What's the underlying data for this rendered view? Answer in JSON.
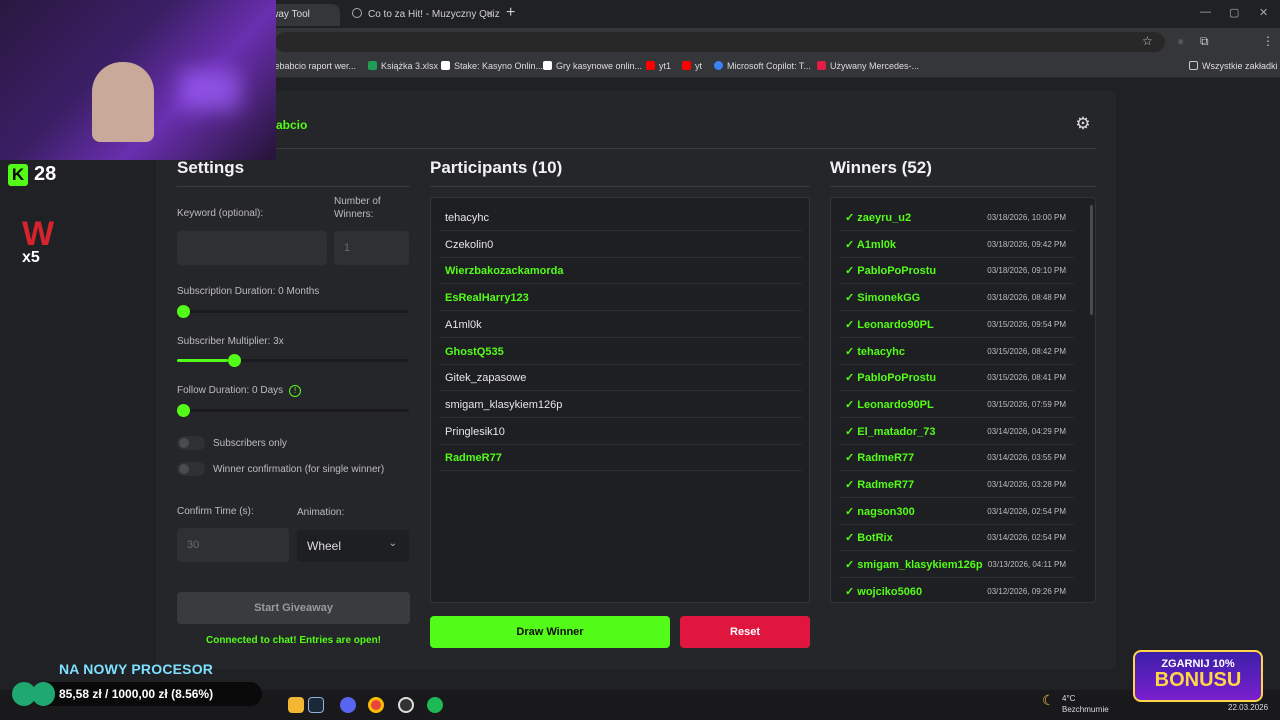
{
  "browser": {
    "tabs": [
      {
        "label": "eaway Tool"
      },
      {
        "label": "Co to za Hit! - Muzyczny Quiz"
      }
    ],
    "bookmarks": [
      {
        "label": "kebabcio raport wer...",
        "color": "#d0d0d0"
      },
      {
        "label": "Książka 3.xlsx",
        "color": "#1f9d55"
      },
      {
        "label": "Stake: Kasyno Onlin...",
        "color": "#ffffff"
      },
      {
        "label": "Gry kasynowe onlin...",
        "color": "#ffffff"
      },
      {
        "label": "yt1",
        "color": "#ff0000"
      },
      {
        "label": "yt",
        "color": "#ff0000"
      },
      {
        "label": "Microsoft Copilot: T...",
        "color": "#3b82f6"
      },
      {
        "label": "Używany Mercedes-...",
        "color": "#e11d48"
      }
    ],
    "all_bookmarks": "Wszystkie zakładki"
  },
  "stream_overlay": {
    "kick_count": "28",
    "kick_letter": "K",
    "logo_w": "W",
    "logo_x5": "x5",
    "goal_title": "NA NOWY PROCESOR",
    "goal_text": "85,58 zł / 1000,00 zł (8.56%)",
    "goal_progress_fraction": 0.0856,
    "bonus_line1": "ZGARNIJ 10%",
    "bonus_line2": "BONUSU"
  },
  "app": {
    "brand": "abcio",
    "settings": {
      "title": "Settings",
      "keyword_label": "Keyword (optional):",
      "keyword_value": "",
      "winners_label": "Number of Winners:",
      "winners_value": "1",
      "sub_duration_label": "Subscription Duration: 0 Months",
      "sub_duration_value": 0,
      "sub_multiplier_label": "Subscriber Multiplier: 3x",
      "sub_multiplier_fraction": 0.22,
      "follow_label": "Follow Duration:  0  Days",
      "follow_value": 0,
      "subscribers_only_label": "Subscribers only",
      "winner_confirm_label": "Winner confirmation (for single winner)",
      "confirm_time_label": "Confirm Time (s):",
      "confirm_time_placeholder": "30",
      "animation_label": "Animation:",
      "animation_value": "Wheel",
      "start_button": "Start Giveaway",
      "status": "Connected to chat! Entries are open!"
    },
    "participants": {
      "title": "Participants (10)",
      "items": [
        {
          "name": "tehacyhc",
          "subscriber": false
        },
        {
          "name": "Czekolin0",
          "subscriber": false
        },
        {
          "name": "Wierzbakozackamorda",
          "subscriber": true
        },
        {
          "name": "EsRealHarry123",
          "subscriber": true
        },
        {
          "name": "A1ml0k",
          "subscriber": false
        },
        {
          "name": "GhostQ535",
          "subscriber": true
        },
        {
          "name": "Gitek_zapasowe",
          "subscriber": false
        },
        {
          "name": "smigam_klasykiem126p",
          "subscriber": false
        },
        {
          "name": "Pringlesik10",
          "subscriber": false
        },
        {
          "name": "RadmeR77",
          "subscriber": true
        }
      ]
    },
    "winners": {
      "title": "Winners (52)",
      "items": [
        {
          "name": "✓ zaeyru_u2",
          "date": "03/18/2026, 10:00 PM"
        },
        {
          "name": "✓ A1ml0k",
          "date": "03/18/2026, 09:42 PM"
        },
        {
          "name": "✓ PabloPoProstu",
          "date": "03/18/2026, 09:10 PM"
        },
        {
          "name": "✓ SimonekGG",
          "date": "03/18/2026, 08:48 PM"
        },
        {
          "name": "✓ Leonardo90PL",
          "date": "03/15/2026, 09:54 PM"
        },
        {
          "name": "✓ tehacyhc",
          "date": "03/15/2026, 08:42 PM"
        },
        {
          "name": "✓ PabloPoProstu",
          "date": "03/15/2026, 08:41 PM"
        },
        {
          "name": "✓ Leonardo90PL",
          "date": "03/15/2026, 07:59 PM"
        },
        {
          "name": "✓ El_matador_73",
          "date": "03/14/2026, 04:29 PM"
        },
        {
          "name": "✓ RadmeR77",
          "date": "03/14/2026, 03:55 PM"
        },
        {
          "name": "✓ RadmeR77",
          "date": "03/14/2026, 03:28 PM"
        },
        {
          "name": "✓ nagson300",
          "date": "03/14/2026, 02:54 PM"
        },
        {
          "name": "✓ BotRix",
          "date": "03/14/2026, 02:54 PM"
        },
        {
          "name": "✓ smigam_klasykiem126p",
          "date": "03/13/2026, 04:11 PM"
        },
        {
          "name": "✓ wojciko5060",
          "date": "03/12/2026, 09:26 PM"
        }
      ]
    },
    "draw_button": "Draw Winner",
    "reset_button": "Reset"
  },
  "taskbar": {
    "weather_temp": "4°C",
    "weather_desc": "Bezchmurnie",
    "date": "22.03.2026"
  }
}
